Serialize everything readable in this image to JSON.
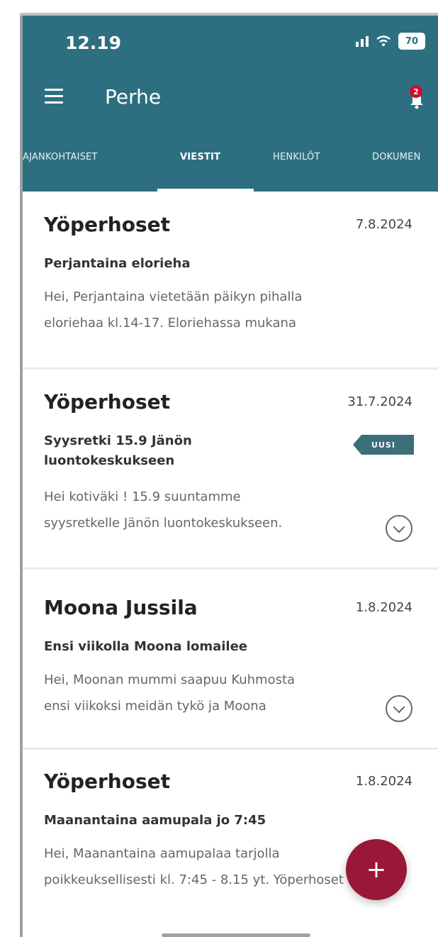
{
  "colors": {
    "header_bg": "#2d6f81",
    "fab_bg": "#9a1738",
    "badge_bg": "#3c6f79",
    "notification_badge": "#c8102e"
  },
  "status_bar": {
    "time": "12.19",
    "battery": "70"
  },
  "header": {
    "menu_icon": "hamburger-icon",
    "title": "Perhe",
    "notification_count": "2",
    "notification_icon": "bell-icon"
  },
  "tabs": [
    {
      "label": "AJANKOHTAISET",
      "active": false
    },
    {
      "label": "VIESTIT",
      "active": true
    },
    {
      "label": "HENKILÖT",
      "active": false
    },
    {
      "label": "DOKUMEN",
      "active": false
    }
  ],
  "messages": [
    {
      "sender": "Yöperhoset",
      "date": "7.8.2024",
      "subject": "Perjantaina elorieha",
      "preview": [
        "Hei, Perjantaina vietetään päikyn pihalla",
        "eloriehaa kl.14-17. Eloriehassa mukana"
      ],
      "new": false,
      "expandable": false
    },
    {
      "sender": "Yöperhoset",
      "date": "31.7.2024",
      "subject": "Syysretki 15.9 Jänön luontokeskukseen",
      "preview": [
        "Hei kotiväki ! 15.9 suuntamme",
        "syysretkelle Jänön luontokeskukseen."
      ],
      "new": true,
      "new_label": "UUSI",
      "expandable": true,
      "expand_icon": "chevron-down-circle-icon"
    },
    {
      "sender": "Moona Jussila",
      "date": "1.8.2024",
      "subject": "Ensi viikolla Moona lomailee",
      "preview": [
        "Hei, Moonan mummi saapuu Kuhmosta",
        "ensi viikoksi meidän tykö ja Moona"
      ],
      "new": false,
      "expandable": true,
      "expand_icon": "chevron-down-circle-icon"
    },
    {
      "sender": "Yöperhoset",
      "date": "1.8.2024",
      "subject": "Maanantaina aamupala jo 7:45",
      "preview": [
        "Hei, Maanantaina aamupalaa tarjolla",
        "poikkeuksellisesti kl. 7:45 - 8.15 yt. Yöperhoset"
      ],
      "new": false,
      "expandable": false
    }
  ],
  "fab": {
    "label": "+",
    "icon": "plus-icon"
  }
}
